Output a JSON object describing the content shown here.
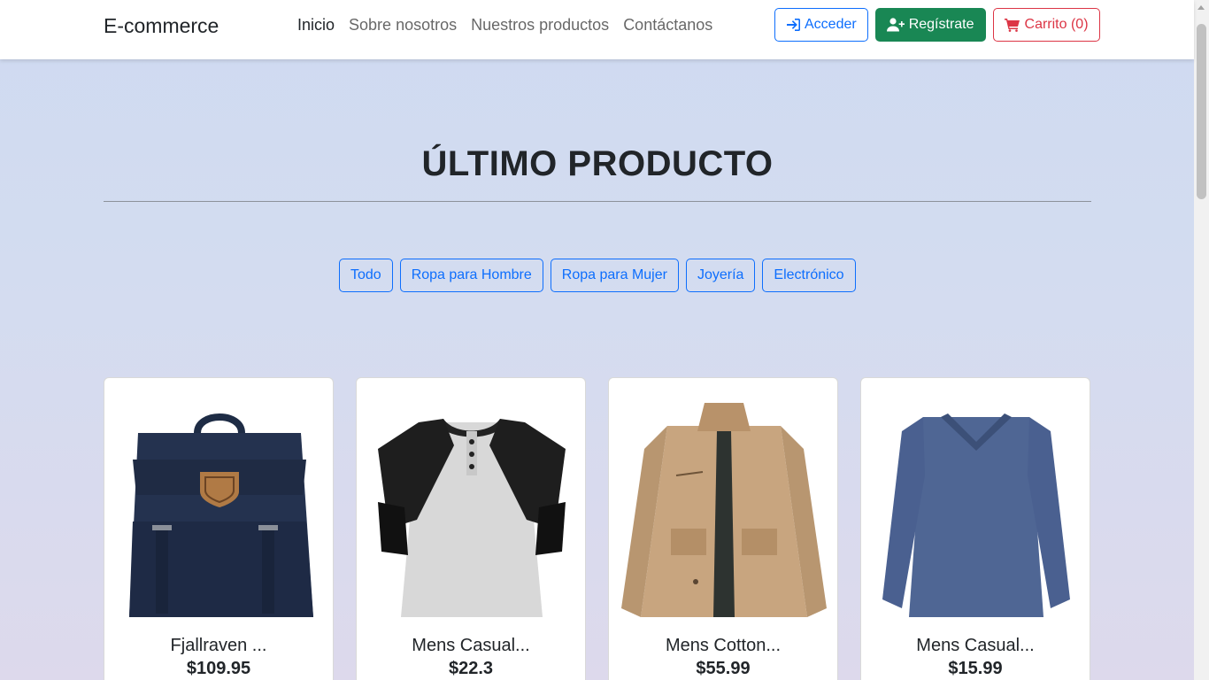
{
  "navbar": {
    "brand": "E-commerce",
    "links": [
      {
        "label": "Inicio"
      },
      {
        "label": "Sobre nosotros"
      },
      {
        "label": "Nuestros productos"
      },
      {
        "label": "Contáctanos"
      }
    ],
    "login_label": "Acceder",
    "register_label": "Regístrate",
    "cart_label": "Carrito (0)"
  },
  "section": {
    "title": "ÚLTIMO PRODUCTO"
  },
  "filters": [
    {
      "label": "Todo"
    },
    {
      "label": "Ropa para Hombre"
    },
    {
      "label": "Ropa para Mujer"
    },
    {
      "label": "Joyería"
    },
    {
      "label": "Electrónico"
    }
  ],
  "products": [
    {
      "title": "Fjallraven ...",
      "price": "$109.95",
      "image": "navy-backpack"
    },
    {
      "title": "Mens Casual...",
      "price": "$22.3",
      "image": "raglan-henley-tshirt"
    },
    {
      "title": "Mens Cotton...",
      "price": "$55.99",
      "image": "khaki-cotton-jacket"
    },
    {
      "title": "Mens Casual...",
      "price": "$15.99",
      "image": "blue-long-sleeve-tshirt"
    }
  ],
  "colors": {
    "primary": "#0d6efd",
    "success": "#198754",
    "danger": "#dc3545"
  }
}
